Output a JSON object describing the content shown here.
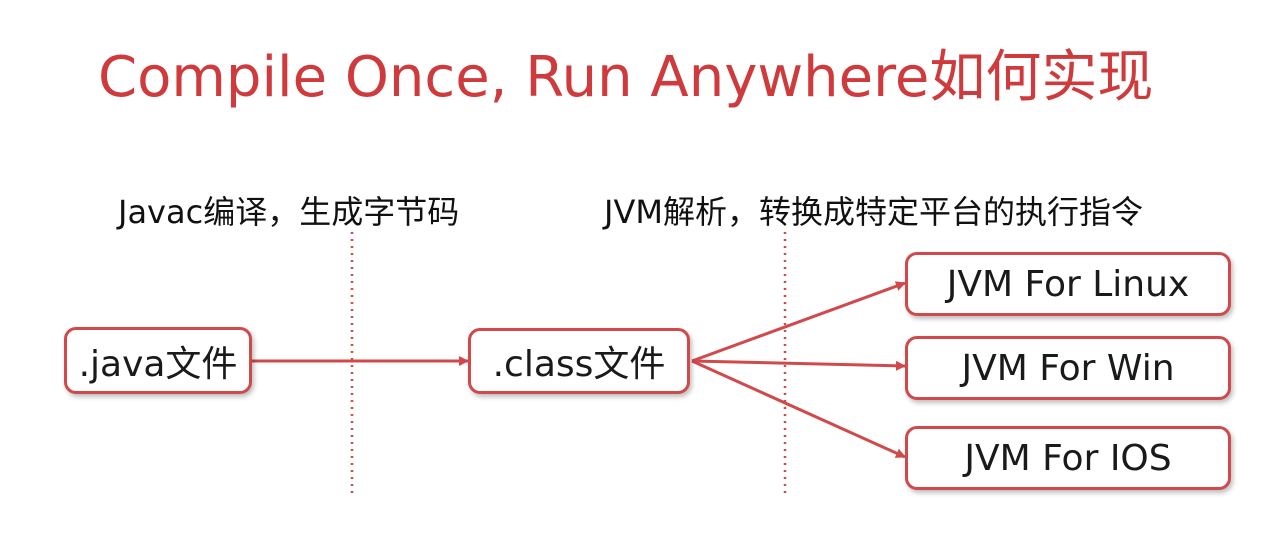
{
  "title": "Compile Once, Run Anywhere如何实现",
  "captions": {
    "compile": "Javac编译，生成字节码",
    "interpret": "JVM解析，转换成特定平台的执行指令"
  },
  "nodes": {
    "java_file": ".java文件",
    "class_file": ".class文件",
    "jvm_linux": "JVM For Linux",
    "jvm_win": "JVM For Win",
    "jvm_ios": "JVM For IOS"
  },
  "colors": {
    "accent": "#cf3b3d",
    "border": "#d0494b",
    "text": "#111111"
  }
}
